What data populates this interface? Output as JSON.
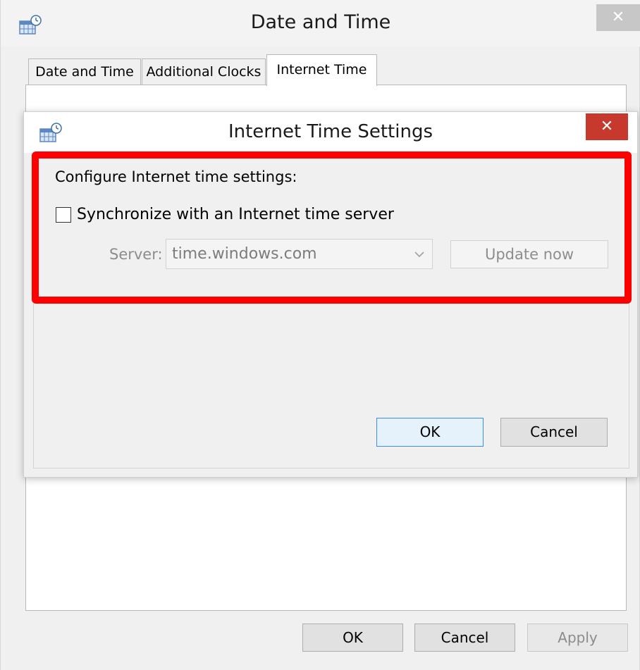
{
  "outer_window": {
    "title": "Date and Time",
    "close_glyph": "✕",
    "icon": "date-time-settings-icon",
    "tabs": [
      {
        "label": "Date and Time",
        "active": false
      },
      {
        "label": "Additional Clocks",
        "active": false
      },
      {
        "label": "Internet Time",
        "active": true
      }
    ],
    "buttons": {
      "ok": "OK",
      "cancel": "Cancel",
      "apply": "Apply"
    }
  },
  "inner_dialog": {
    "title": "Internet Time Settings",
    "close_glyph": "✕",
    "icon": "date-time-settings-icon",
    "heading": "Configure Internet time settings:",
    "sync_checkbox": {
      "label": "Synchronize with an Internet time server",
      "checked": false
    },
    "server": {
      "label": "Server:",
      "value": "time.windows.com",
      "enabled": false
    },
    "update_button": "Update now",
    "buttons": {
      "ok": "OK",
      "cancel": "Cancel"
    }
  },
  "colors": {
    "highlight": "#ff0000",
    "inner_close_bg": "#c7392c",
    "outer_close_bg": "#c7c7c7",
    "default_button_border": "#3c8ee6"
  }
}
